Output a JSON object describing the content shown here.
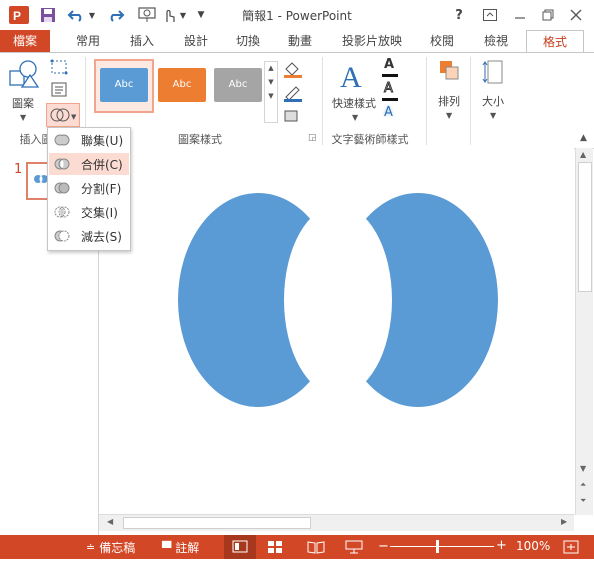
{
  "window": {
    "title": "簡報1 - PowerPoint",
    "help": "?"
  },
  "tabs": [
    {
      "label": "檔案"
    },
    {
      "label": "常用"
    },
    {
      "label": "插入"
    },
    {
      "label": "設計"
    },
    {
      "label": "切換"
    },
    {
      "label": "動畫"
    },
    {
      "label": "投影片放映"
    },
    {
      "label": "校閱"
    },
    {
      "label": "檢視"
    },
    {
      "label": "格式"
    }
  ],
  "ribbon": {
    "insert_shapes": {
      "shapes_label": "圖案",
      "group_label": "插入圖"
    },
    "shape_styles": {
      "group_label": "圖案樣式",
      "styles": [
        {
          "text": "Abc",
          "color": "#5b9bd5"
        },
        {
          "text": "Abc",
          "color": "#ed7d31"
        },
        {
          "text": "Abc",
          "color": "#a5a5a5"
        }
      ]
    },
    "wordart": {
      "quick_styles_label": "快速樣式",
      "group_label": "文字藝術師樣式",
      "glyph": "A"
    },
    "arrange": {
      "label": "排列"
    },
    "size": {
      "label": "大小"
    }
  },
  "merge_menu": {
    "items": [
      {
        "label": "聯集(U)",
        "highlighted": false
      },
      {
        "label": "合併(C)",
        "highlighted": true
      },
      {
        "label": "分割(F)",
        "highlighted": false
      },
      {
        "label": "交集(I)",
        "highlighted": false
      },
      {
        "label": "減去(S)",
        "highlighted": false
      }
    ]
  },
  "thumbnails": [
    {
      "number": "1"
    }
  ],
  "slide": {
    "shape_color": "#5b9bd5"
  },
  "statusbar": {
    "notes_label": "備忘稿",
    "comments_label": "註解",
    "zoom": "100%"
  },
  "colors": {
    "accent": "#d24726",
    "highlight": "#fcdcd2"
  }
}
